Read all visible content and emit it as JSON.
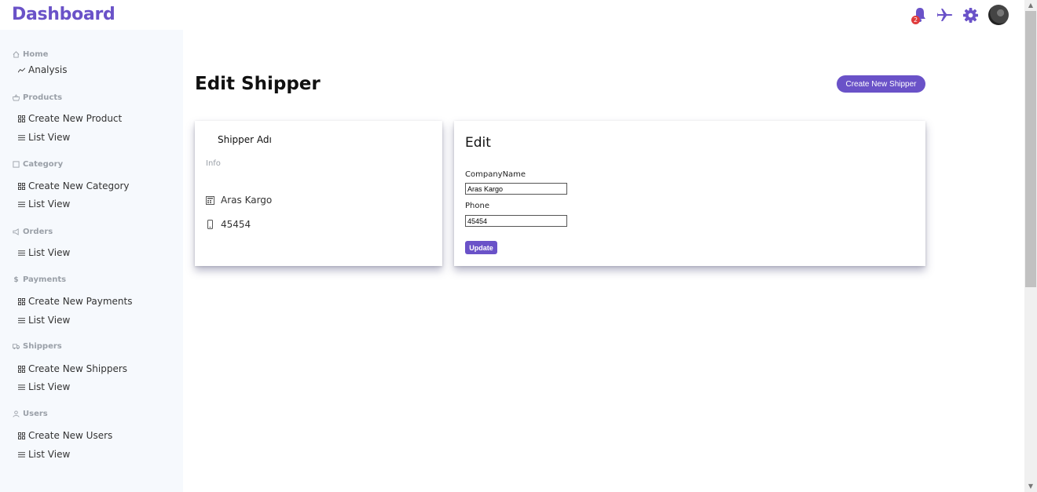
{
  "header": {
    "brand": "Dashboard",
    "notification_count": "2",
    "icons": [
      "bell-icon",
      "plane-icon",
      "gear-icon",
      "avatar"
    ]
  },
  "sidebar": {
    "sections": [
      {
        "label": "Home",
        "icon": "home-icon",
        "items": [
          {
            "label": "Analysis",
            "icon": "trend-icon"
          }
        ]
      },
      {
        "label": "Products",
        "icon": "basket-icon",
        "items": [
          {
            "label": "Create New Product",
            "icon": "grid-icon"
          },
          {
            "label": "List View",
            "icon": "list-icon"
          }
        ]
      },
      {
        "label": "Category",
        "icon": "square-icon",
        "items": [
          {
            "label": "Create New Category",
            "icon": "grid-icon"
          },
          {
            "label": "List View",
            "icon": "list-icon"
          }
        ]
      },
      {
        "label": "Orders",
        "icon": "megaphone-icon",
        "items": [
          {
            "label": "List View",
            "icon": "list-icon"
          }
        ]
      },
      {
        "label": "Payments",
        "icon": "dollar-icon",
        "items": [
          {
            "label": "Create New Payments",
            "icon": "grid-icon"
          },
          {
            "label": "List View",
            "icon": "list-icon"
          }
        ]
      },
      {
        "label": "Shippers",
        "icon": "truck-icon",
        "items": [
          {
            "label": "Create New Shippers",
            "icon": "grid-icon"
          },
          {
            "label": "List View",
            "icon": "list-icon"
          }
        ]
      },
      {
        "label": "Users",
        "icon": "user-icon",
        "items": [
          {
            "label": "Create New Users",
            "icon": "grid-icon"
          },
          {
            "label": "List View",
            "icon": "list-icon"
          }
        ]
      }
    ]
  },
  "main": {
    "title": "Edit Shipper",
    "create_button": "Create New Shipper",
    "info_card": {
      "name_label": "Shipper Adı",
      "info_label": "Info",
      "company": "Aras Kargo",
      "phone": "45454"
    },
    "edit_card": {
      "title": "Edit",
      "company_label": "CompanyName",
      "company_value": "Aras Kargo",
      "phone_label": "Phone",
      "phone_value": "45454",
      "update_button": "Update"
    }
  },
  "colors": {
    "accent": "#6a52c8",
    "badge": "#e03b3b",
    "sidebar_bg": "#f6f9fd"
  }
}
